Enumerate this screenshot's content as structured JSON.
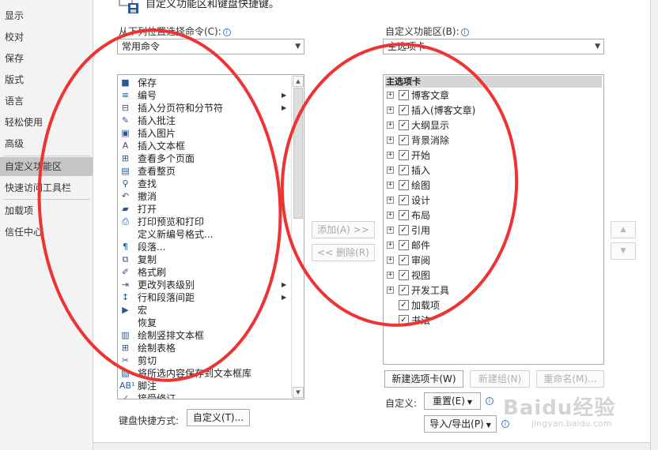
{
  "nav": {
    "items": [
      {
        "label": "显示",
        "selected": false
      },
      {
        "label": "校对",
        "selected": false
      },
      {
        "label": "保存",
        "selected": false
      },
      {
        "label": "版式",
        "selected": false
      },
      {
        "label": "语言",
        "selected": false
      },
      {
        "label": "轻松使用",
        "selected": false
      },
      {
        "label": "高级",
        "selected": false
      },
      {
        "label": "自定义功能区",
        "selected": true
      },
      {
        "label": "快速访问工具栏",
        "selected": false
      },
      {
        "label": "加载项",
        "selected": false
      },
      {
        "label": "信任中心",
        "selected": false
      }
    ]
  },
  "header": {
    "title": "自定义功能区和键盘快捷键。"
  },
  "left": {
    "choose_label": "从下列位置选择命令(C):",
    "choose_value": "常用命令",
    "commands": [
      {
        "label": "保存",
        "icon": "save-icon",
        "glyph": "■",
        "submenu": false
      },
      {
        "label": "编号",
        "icon": "numbering-icon",
        "glyph": "≡",
        "submenu": true
      },
      {
        "label": "插入分页符和分节符",
        "icon": "page-break-icon",
        "glyph": "⊟",
        "submenu": true
      },
      {
        "label": "插入批注",
        "icon": "comment-icon",
        "glyph": "✎",
        "submenu": false
      },
      {
        "label": "插入图片",
        "icon": "picture-icon",
        "glyph": "▣",
        "submenu": false
      },
      {
        "label": "插入文本框",
        "icon": "textbox-icon",
        "glyph": "A",
        "submenu": false
      },
      {
        "label": "查看多个页面",
        "icon": "multi-page-icon",
        "glyph": "⊞",
        "submenu": false
      },
      {
        "label": "查看整页",
        "icon": "one-page-icon",
        "glyph": "▤",
        "submenu": false
      },
      {
        "label": "查找",
        "icon": "find-icon",
        "glyph": "⚲",
        "submenu": false
      },
      {
        "label": "撤消",
        "icon": "undo-icon",
        "glyph": "↶",
        "submenu": false
      },
      {
        "label": "打开",
        "icon": "open-folder-icon",
        "glyph": "▰",
        "submenu": false
      },
      {
        "label": "打印预览和打印",
        "icon": "print-preview-icon",
        "glyph": "⎙",
        "submenu": false
      },
      {
        "label": "定义新编号格式...",
        "icon": "",
        "glyph": "",
        "submenu": false
      },
      {
        "label": "段落...",
        "icon": "paragraph-icon",
        "glyph": "¶",
        "submenu": false
      },
      {
        "label": "复制",
        "icon": "copy-icon",
        "glyph": "⧉",
        "submenu": false
      },
      {
        "label": "格式刷",
        "icon": "format-painter-icon",
        "glyph": "✐",
        "submenu": false
      },
      {
        "label": "更改列表级别",
        "icon": "list-level-icon",
        "glyph": "⇥",
        "submenu": true
      },
      {
        "label": "行和段落间距",
        "icon": "line-spacing-icon",
        "glyph": "↕",
        "submenu": true
      },
      {
        "label": "宏",
        "icon": "macro-icon",
        "glyph": "▶",
        "submenu": false
      },
      {
        "label": "恢复",
        "icon": "",
        "glyph": "",
        "submenu": false
      },
      {
        "label": "绘制竖排文本框",
        "icon": "vertical-textbox-icon",
        "glyph": "▥",
        "submenu": false
      },
      {
        "label": "绘制表格",
        "icon": "draw-table-icon",
        "glyph": "⊞",
        "submenu": false
      },
      {
        "label": "剪切",
        "icon": "cut-icon",
        "glyph": "✂",
        "submenu": false
      },
      {
        "label": "将所选内容保存到文本框库",
        "icon": "textbox-gallery-icon",
        "glyph": "▧",
        "submenu": false
      },
      {
        "label": "脚注",
        "icon": "footnote-icon",
        "glyph": "AB¹",
        "submenu": false
      },
      {
        "label": "接受修订",
        "icon": "accept-change-icon",
        "glyph": "✓",
        "submenu": false
      }
    ],
    "keyboard_label": "键盘快捷方式:",
    "customize_button": "自定义(T)..."
  },
  "middle": {
    "add_button": "添加(A) >>",
    "remove_button": "<< 删除(R)"
  },
  "right": {
    "ribbon_label": "自定义功能区(B):",
    "ribbon_value": "主选项卡",
    "tree_header": "主选项卡",
    "tabs": [
      {
        "label": "博客文章",
        "expandable": true,
        "checked": true
      },
      {
        "label": "插入(博客文章)",
        "expandable": true,
        "checked": true
      },
      {
        "label": "大纲显示",
        "expandable": true,
        "checked": true
      },
      {
        "label": "背景消除",
        "expandable": true,
        "checked": true
      },
      {
        "label": "开始",
        "expandable": true,
        "checked": true
      },
      {
        "label": "插入",
        "expandable": true,
        "checked": true
      },
      {
        "label": "绘图",
        "expandable": true,
        "checked": true
      },
      {
        "label": "设计",
        "expandable": true,
        "checked": true
      },
      {
        "label": "布局",
        "expandable": true,
        "checked": true
      },
      {
        "label": "引用",
        "expandable": true,
        "checked": true
      },
      {
        "label": "邮件",
        "expandable": true,
        "checked": true
      },
      {
        "label": "审阅",
        "expandable": true,
        "checked": true
      },
      {
        "label": "视图",
        "expandable": true,
        "checked": true
      },
      {
        "label": "开发工具",
        "expandable": true,
        "checked": true
      },
      {
        "label": "加载项",
        "expandable": false,
        "checked": true
      },
      {
        "label": "书法",
        "expandable": false,
        "checked": true
      }
    ],
    "new_tab_button": "新建选项卡(W)",
    "new_group_button": "新建组(N)",
    "rename_button": "重命名(M)...",
    "customizations_label": "自定义:",
    "reset_button": "重置(E)",
    "import_export_button": "导入/导出(P)"
  },
  "watermark": {
    "text": "Baidu经验",
    "url": "jingyan.baidu.com"
  },
  "colors": {
    "annotation": "#ee3333",
    "selected_nav": "#c6c6c6",
    "info": "#3a7cc8"
  }
}
